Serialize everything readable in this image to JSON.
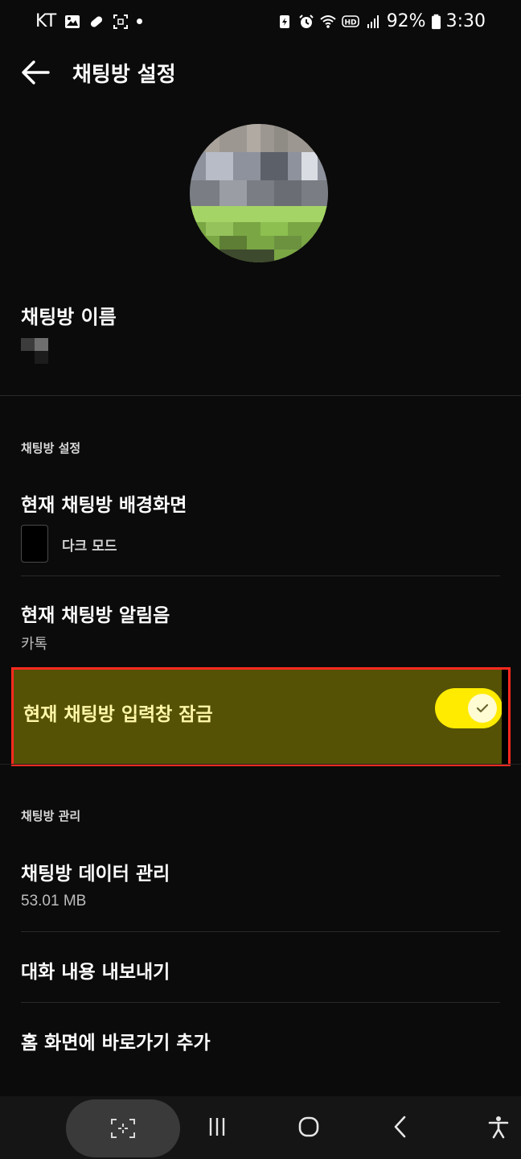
{
  "status_bar": {
    "carrier": "KT",
    "battery": "92%",
    "time": "3:30"
  },
  "app_bar": {
    "title": "채팅방 설정"
  },
  "room_name": {
    "label": "채팅방 이름"
  },
  "chat_settings": {
    "section_label": "채팅방 설정",
    "background": {
      "title": "현재 채팅방 배경화면",
      "value": "다크 모드"
    },
    "notification_sound": {
      "title": "현재 채팅방 알림음",
      "value": "카톡"
    },
    "input_lock": {
      "title": "현재 채팅방 입력창 잠금",
      "enabled": true
    }
  },
  "chat_management": {
    "section_label": "채팅방 관리",
    "data_management": {
      "title": "채팅방 데이터 관리",
      "size": "53.01 MB"
    },
    "export": {
      "title": "대화 내용 내보내기"
    },
    "shortcut": {
      "title": "홈 화면에 바로가기 추가"
    }
  },
  "colors": {
    "background": "#0b0b0b",
    "toggle_on": "#ffeb00",
    "highlight_fill": "#555206",
    "highlight_border": "#ff2a1f"
  },
  "icons": {
    "back": "arrow-left-icon",
    "toggle_check": "check-icon",
    "nav_capture": "capture-icon",
    "nav_recents": "recents-icon",
    "nav_home": "home-icon",
    "nav_back": "chevron-left-icon",
    "nav_accessibility": "accessibility-icon"
  }
}
